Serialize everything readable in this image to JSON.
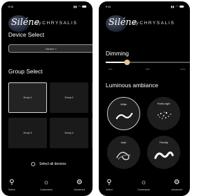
{
  "status_bar": {
    "time": "9:41",
    "signal_icon": "signal-icon",
    "wifi_icon": "wifi-icon",
    "battery_icon": "battery-icon"
  },
  "brand": {
    "script": "Siléne",
    "by": "by",
    "name": "CHRYSALIS"
  },
  "left_screen": {
    "device_select_title": "Device Select",
    "device_dropdown": "Device  ˅",
    "group_select_title": "Group Select",
    "groups": [
      {
        "label": "Group 1",
        "selected": true
      },
      {
        "label": "Group 2",
        "selected": false
      },
      {
        "label": "Group 3",
        "selected": false
      },
      {
        "label": "Group 4",
        "selected": false
      }
    ],
    "select_all_label": "Select all devices"
  },
  "right_screen": {
    "dimming_title": "Dimming",
    "dimming_level_percent": 25,
    "dimming_ticks": [
      "OFF",
      "50%",
      "100%"
    ],
    "ambiance_title": "Luminous ambiance",
    "ambiances": [
      {
        "label": "White",
        "selected": true,
        "icon": "wave-icon"
      },
      {
        "label": "Poetic night",
        "selected": false,
        "icon": "sparkle-icon"
      },
      {
        "label": "Idyle",
        "selected": false,
        "icon": "swirl-icon"
      },
      {
        "label": "Friendly",
        "selected": false,
        "icon": "loop-icon"
      }
    ]
  },
  "tabbar": [
    {
      "label": "Select",
      "icon": "search-icon"
    },
    {
      "label": "Commands",
      "icon": "bulb-icon"
    },
    {
      "label": "Advanced",
      "icon": "gear-icon"
    }
  ],
  "colors": {
    "background": "#000000",
    "slider_thumb": "#e7c68d",
    "selected_border": "#d8d8d8"
  }
}
